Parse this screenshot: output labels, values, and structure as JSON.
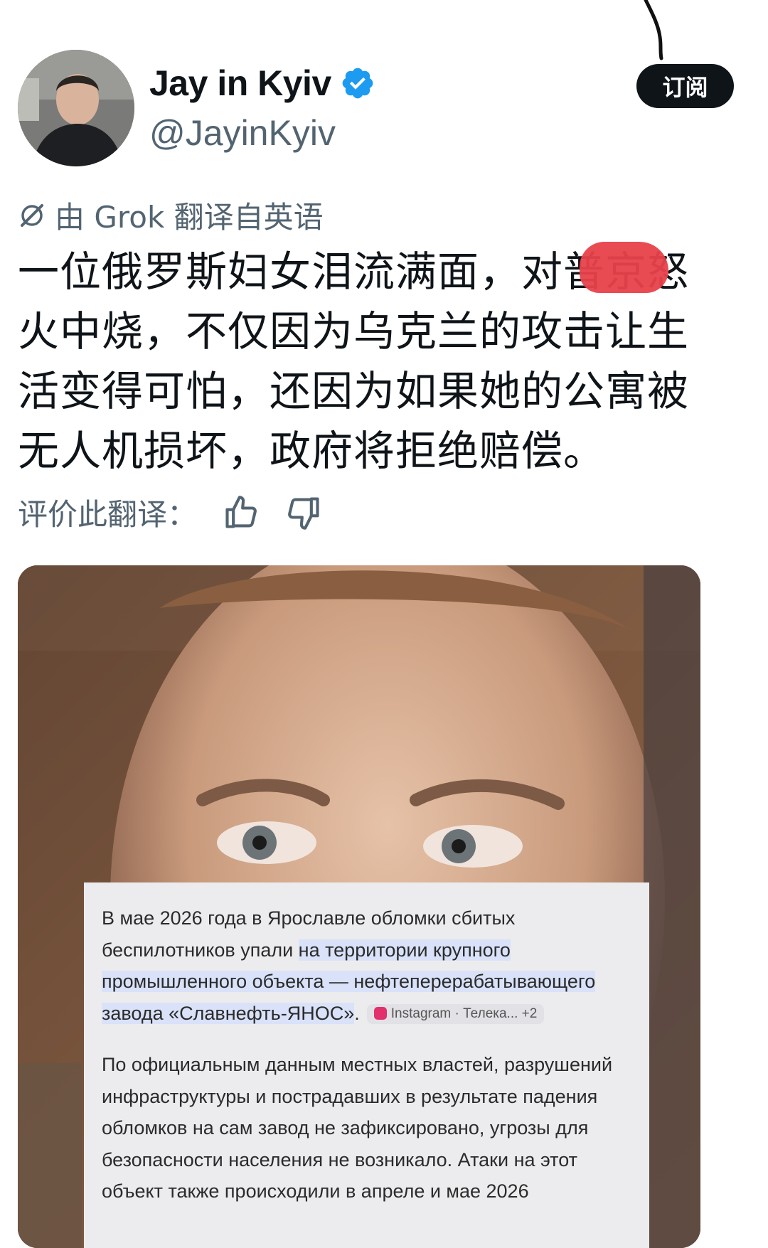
{
  "profile": {
    "display_name": "Jay in Kyiv",
    "handle": "@JayinKyiv",
    "verified_badge": "verified-checkmark-icon",
    "badge_color": "#1d9bf0"
  },
  "subscribe_button": {
    "label": "订阅"
  },
  "translation": {
    "note": "由 Grok 翻译自英语",
    "icon": "grok-icon"
  },
  "tweet": {
    "text": "一位俄罗斯妇女泪流满面，对普京怒火中烧，不仅因为乌克兰的攻击让生活变得可怕，还因为如果她的公寓被无人机损坏，政府将拒绝赔偿。",
    "redaction_color": "#e8414a"
  },
  "rate_translation": {
    "label": "评价此翻译：",
    "like_icon": "thumbs-up-icon",
    "dislike_icon": "thumbs-down-icon"
  },
  "media": {
    "overlay_card": {
      "paragraph1_plain": "В мае 2026 года в Ярославле обломки сбитых беспилотников упали ",
      "paragraph1_highlight": "на территории крупного промышленного объекта — нефтеперерабатывающего завода «Славнефть-ЯНОС»",
      "paragraph1_end": ".",
      "source_chip": "Instagram · Телека...   +2",
      "paragraph2": "По официальным данным местных властей, разрушений инфраструктуры и пострадавших в результате падения обломков на сам завод не зафиксировано, угрозы для безопасности населения не возникало. Атаки на этот объект также происходили в апреле и мае 2026"
    }
  }
}
